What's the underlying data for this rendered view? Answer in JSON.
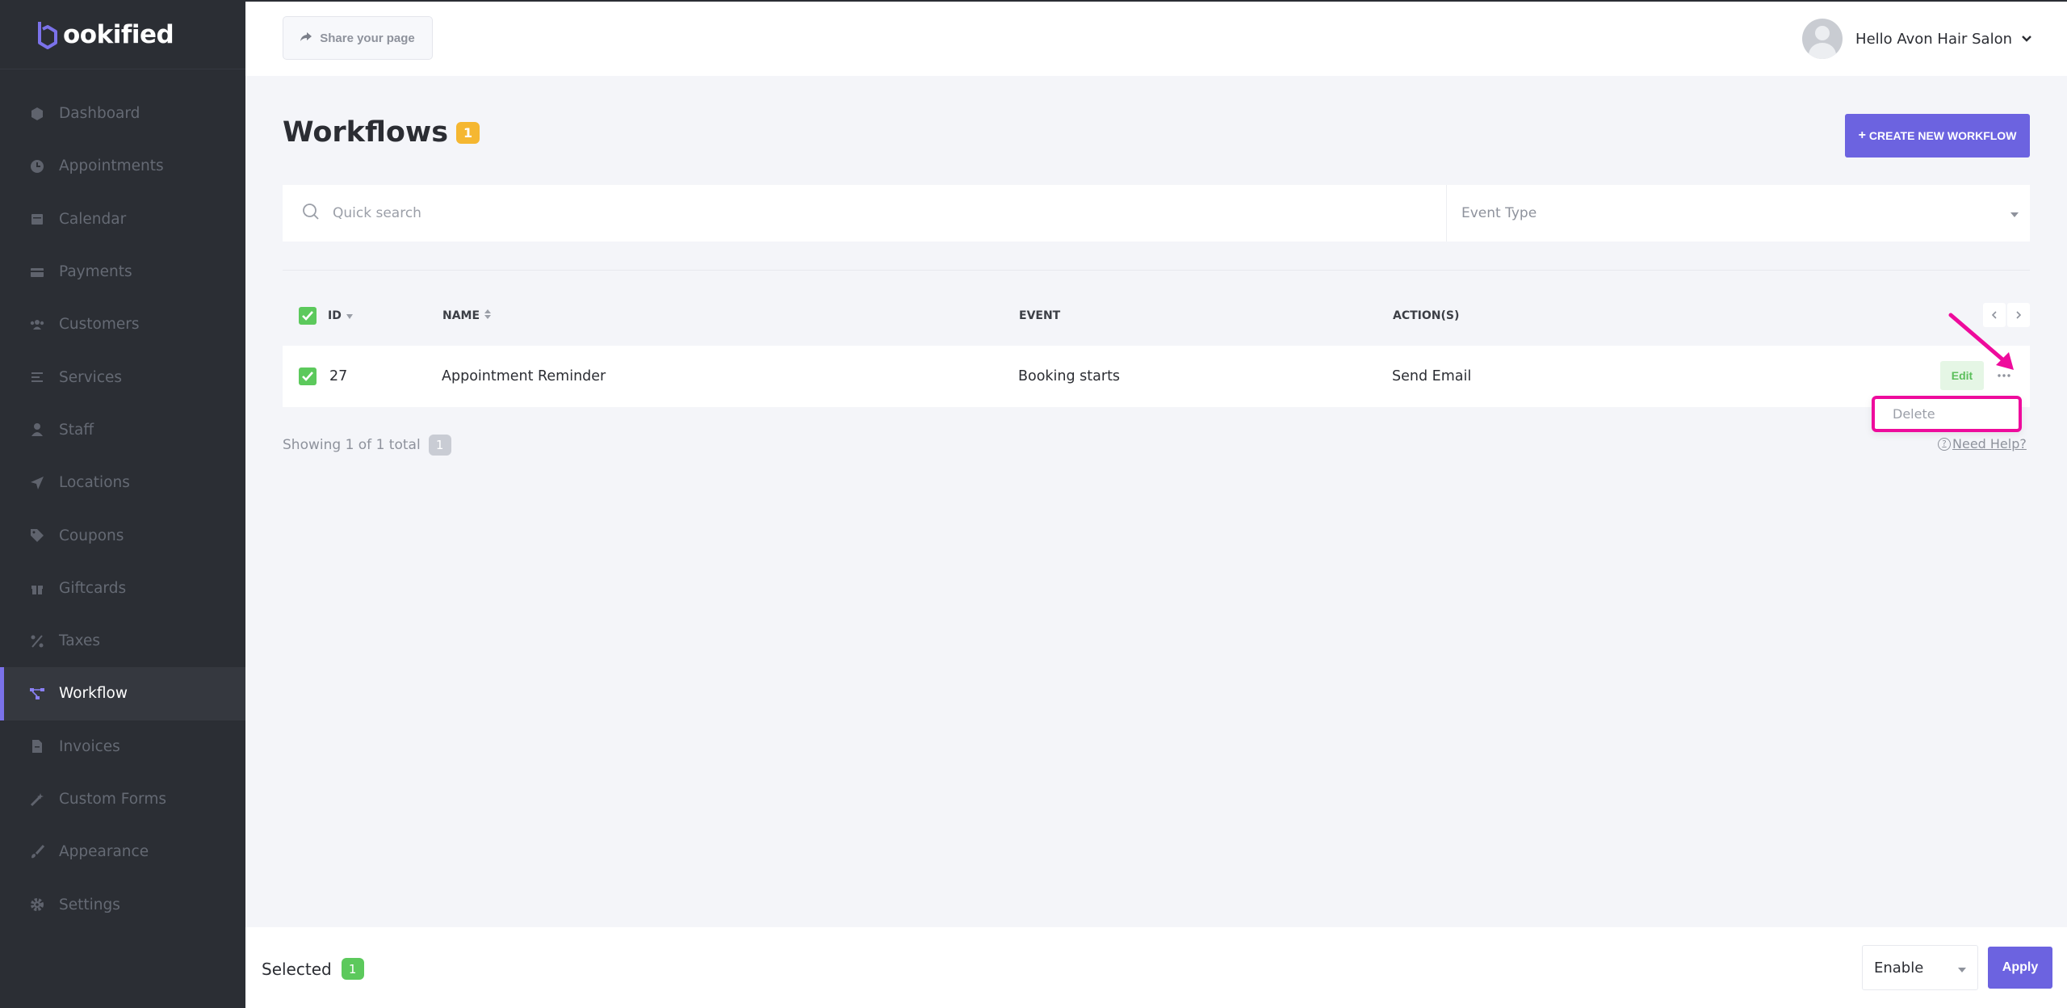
{
  "brand": {
    "logo_text": "ookified",
    "accent": "#6c63e0"
  },
  "sidebar": {
    "items": [
      {
        "label": "Dashboard",
        "icon": "cube-icon"
      },
      {
        "label": "Appointments",
        "icon": "clock-icon"
      },
      {
        "label": "Calendar",
        "icon": "calendar-icon"
      },
      {
        "label": "Payments",
        "icon": "credit-card-icon"
      },
      {
        "label": "Customers",
        "icon": "users-icon"
      },
      {
        "label": "Services",
        "icon": "list-icon"
      },
      {
        "label": "Staff",
        "icon": "user-icon"
      },
      {
        "label": "Locations",
        "icon": "location-arrow-icon"
      },
      {
        "label": "Coupons",
        "icon": "tag-icon"
      },
      {
        "label": "Giftcards",
        "icon": "gift-icon"
      },
      {
        "label": "Taxes",
        "icon": "percent-icon"
      },
      {
        "label": "Workflow",
        "icon": "workflow-icon",
        "active": true
      },
      {
        "label": "Invoices",
        "icon": "file-icon"
      },
      {
        "label": "Custom Forms",
        "icon": "magic-wand-icon"
      },
      {
        "label": "Appearance",
        "icon": "brush-icon"
      },
      {
        "label": "Settings",
        "icon": "gear-icon"
      }
    ]
  },
  "header": {
    "share_label": "Share your page",
    "greeting": "Hello Avon Hair Salon"
  },
  "main": {
    "title": "Workflows",
    "count": "1",
    "create_label": "CREATE NEW WORKFLOW",
    "search_placeholder": "Quick search",
    "event_type_placeholder": "Event Type",
    "columns": {
      "id": "ID",
      "name": "NAME",
      "event": "EVENT",
      "actions": "ACTION(S)"
    },
    "rows": [
      {
        "id": "27",
        "name": "Appointment Reminder",
        "event": "Booking starts",
        "actions": "Send Email"
      }
    ],
    "edit_label": "Edit",
    "dropdown_delete": "Delete",
    "showing_text": "Showing 1 of 1 total",
    "showing_count": "1",
    "help_label": "Need Help?"
  },
  "footer": {
    "selected_label": "Selected",
    "selected_count": "1",
    "bulk_action_value": "Enable",
    "apply_label": "Apply"
  }
}
